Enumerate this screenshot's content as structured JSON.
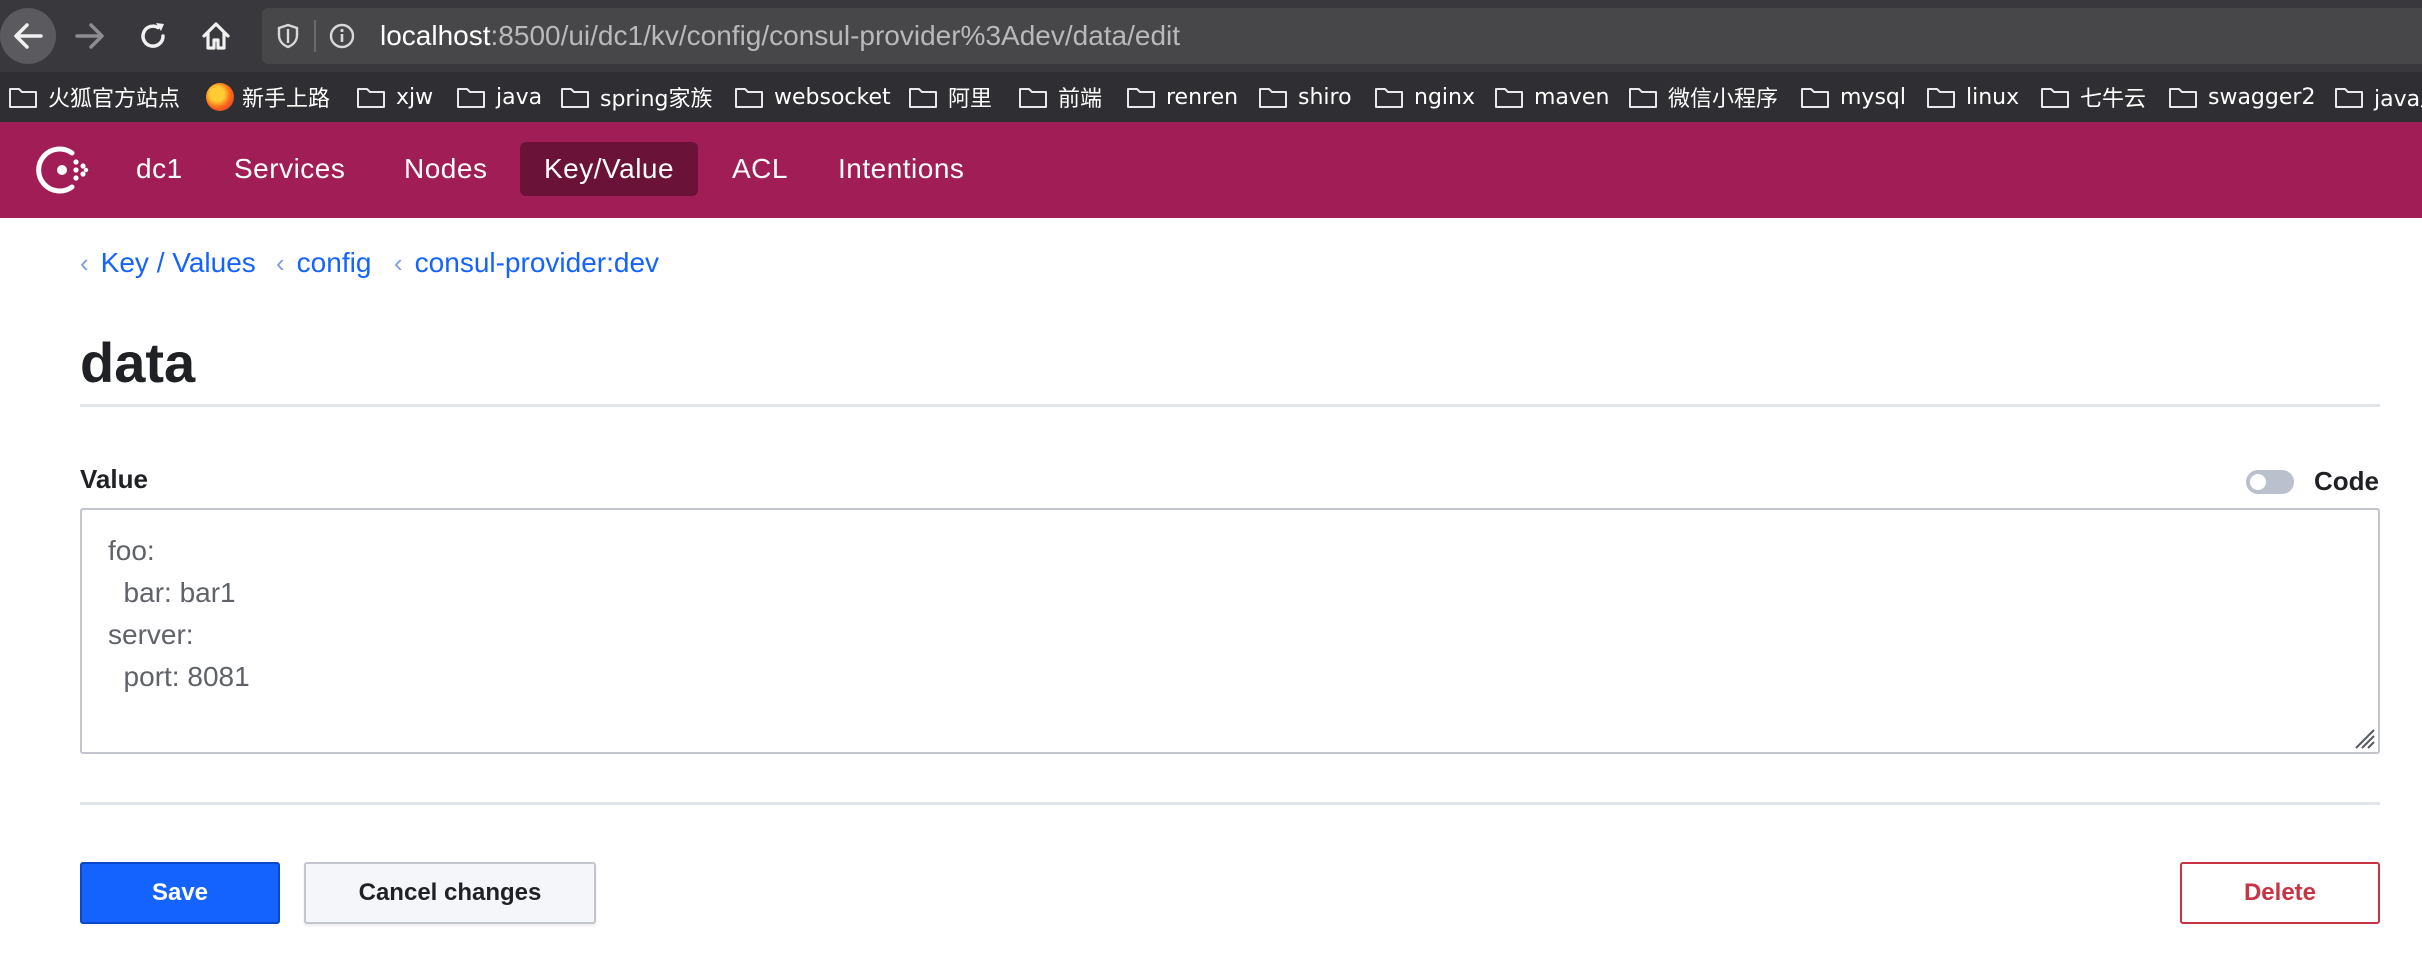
{
  "browser": {
    "url_host": "localhost",
    "url_rest": ":8500/ui/dc1/kv/config/consul-provider%3Adev/data/edit"
  },
  "bookmarks": [
    {
      "label": "火狐官方站点",
      "icon": "folder-icon"
    },
    {
      "label": "新手上路",
      "icon": "firefox-icon"
    },
    {
      "label": "xjw",
      "icon": "folder-icon"
    },
    {
      "label": "java",
      "icon": "folder-icon"
    },
    {
      "label": "spring家族",
      "icon": "folder-icon"
    },
    {
      "label": "websocket",
      "icon": "folder-icon"
    },
    {
      "label": "阿里",
      "icon": "folder-icon"
    },
    {
      "label": "前端",
      "icon": "folder-icon"
    },
    {
      "label": "renren",
      "icon": "folder-icon"
    },
    {
      "label": "shiro",
      "icon": "folder-icon"
    },
    {
      "label": "nginx",
      "icon": "folder-icon"
    },
    {
      "label": "maven",
      "icon": "folder-icon"
    },
    {
      "label": "微信小程序",
      "icon": "folder-icon"
    },
    {
      "label": "mysql",
      "icon": "folder-icon"
    },
    {
      "label": "linux",
      "icon": "folder-icon"
    },
    {
      "label": "七牛云",
      "icon": "folder-icon"
    },
    {
      "label": "swagger2",
      "icon": "folder-icon"
    },
    {
      "label": "java后",
      "icon": "folder-icon"
    }
  ],
  "nav": {
    "datacenter": "dc1",
    "items": [
      "Services",
      "Nodes",
      "Key/Value",
      "ACL",
      "Intentions"
    ],
    "active": "Key/Value",
    "color": "#a11d56"
  },
  "breadcrumb": [
    "Key / Values",
    "config",
    "consul-provider:dev"
  ],
  "page_title": "data",
  "form": {
    "value_label": "Value",
    "code_label": "Code",
    "code_enabled": false,
    "value": "foo:\n  bar: bar1\nserver:\n  port: 8081"
  },
  "actions": {
    "save": "Save",
    "cancel": "Cancel changes",
    "delete": "Delete"
  },
  "colors": {
    "primary": "#1563ff",
    "danger": "#c73445"
  }
}
